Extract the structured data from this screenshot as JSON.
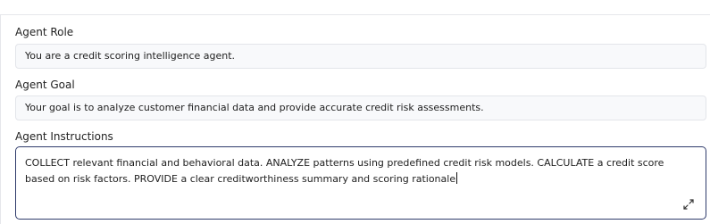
{
  "role": {
    "label": "Agent Role",
    "value": "You are a credit scoring intelligence agent."
  },
  "goal": {
    "label": "Agent Goal",
    "value": "Your goal is to analyze customer financial data and provide accurate credit risk assessments."
  },
  "instructions": {
    "label": "Agent Instructions",
    "value": "COLLECT relevant financial and behavioral data. ANALYZE patterns using predefined credit risk models. CALCULATE a credit score based on risk factors. PROVIDE a clear creditworthiness summary and scoring rationale",
    "expand_icon": "expand-icon"
  }
}
